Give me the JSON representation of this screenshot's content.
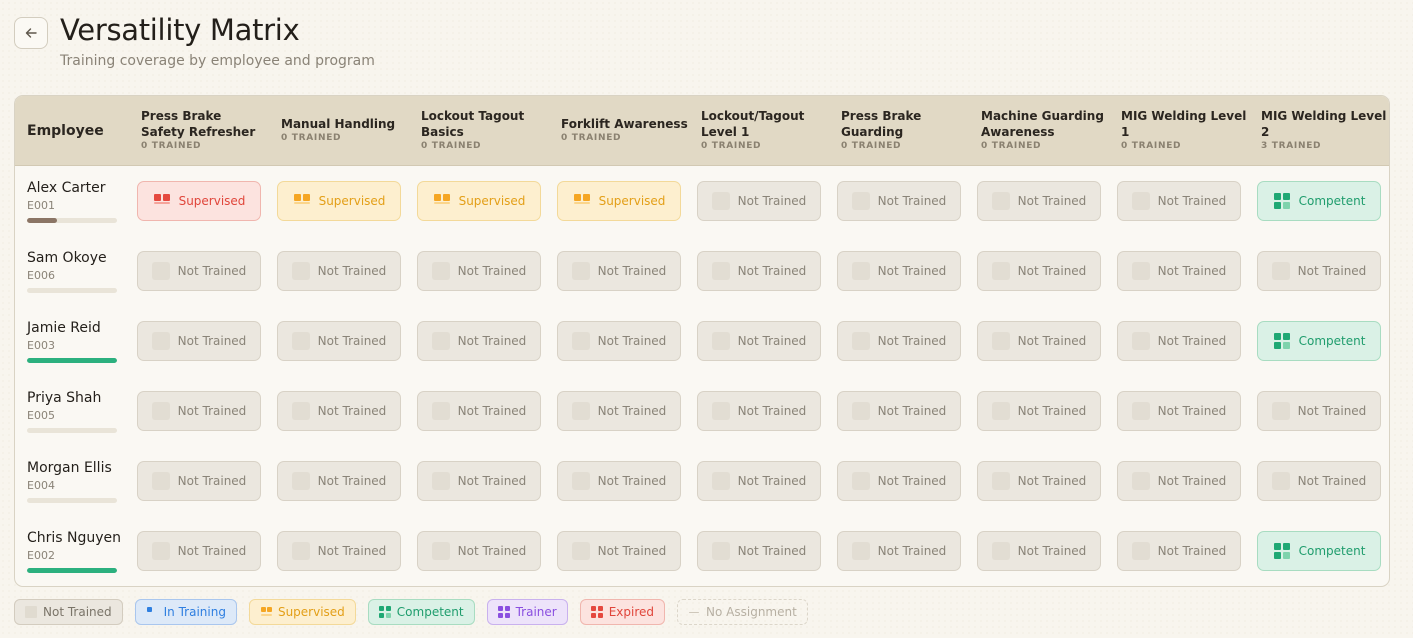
{
  "header": {
    "title": "Versatility Matrix",
    "subtitle": "Training coverage by employee and program",
    "back_icon": "arrow-left-icon"
  },
  "table": {
    "employee_header": "Employee",
    "programs": [
      {
        "name": "Press Brake Safety Refresher",
        "trained": "0 TRAINED"
      },
      {
        "name": "Manual Handling",
        "trained": "0 TRAINED"
      },
      {
        "name": "Lockout Tagout Basics",
        "trained": "0 TRAINED"
      },
      {
        "name": "Forklift Awareness",
        "trained": "0 TRAINED"
      },
      {
        "name": "Lockout/Tagout Level 1",
        "trained": "0 TRAINED"
      },
      {
        "name": "Press Brake Guarding",
        "trained": "0 TRAINED"
      },
      {
        "name": "Machine Guarding Awareness",
        "trained": "0 TRAINED"
      },
      {
        "name": "MIG Welding Level 1",
        "trained": "0 TRAINED"
      },
      {
        "name": "MIG Welding Level 2",
        "trained": "3 TRAINED"
      }
    ],
    "rows": [
      {
        "name": "Alex Carter",
        "id": "E001",
        "progress": 0.33,
        "progress_color": "#8b7565",
        "cells": [
          "Supervised",
          "Supervised",
          "Supervised",
          "Supervised",
          "Not Trained",
          "Not Trained",
          "Not Trained",
          "Not Trained",
          "Competent"
        ],
        "states": [
          "expired-supervised",
          "supervised",
          "supervised",
          "supervised",
          "not-trained",
          "not-trained",
          "not-trained",
          "not-trained",
          "competent"
        ]
      },
      {
        "name": "Sam Okoye",
        "id": "E006",
        "progress": 0,
        "progress_color": "#2bb07e",
        "cells": [
          "Not Trained",
          "Not Trained",
          "Not Trained",
          "Not Trained",
          "Not Trained",
          "Not Trained",
          "Not Trained",
          "Not Trained",
          "Not Trained"
        ],
        "states": [
          "not-trained",
          "not-trained",
          "not-trained",
          "not-trained",
          "not-trained",
          "not-trained",
          "not-trained",
          "not-trained",
          "not-trained"
        ]
      },
      {
        "name": "Jamie Reid",
        "id": "E003",
        "progress": 1,
        "progress_color": "#2bb07e",
        "cells": [
          "Not Trained",
          "Not Trained",
          "Not Trained",
          "Not Trained",
          "Not Trained",
          "Not Trained",
          "Not Trained",
          "Not Trained",
          "Competent"
        ],
        "states": [
          "not-trained",
          "not-trained",
          "not-trained",
          "not-trained",
          "not-trained",
          "not-trained",
          "not-trained",
          "not-trained",
          "competent"
        ]
      },
      {
        "name": "Priya Shah",
        "id": "E005",
        "progress": 0,
        "progress_color": "#2bb07e",
        "cells": [
          "Not Trained",
          "Not Trained",
          "Not Trained",
          "Not Trained",
          "Not Trained",
          "Not Trained",
          "Not Trained",
          "Not Trained",
          "Not Trained"
        ],
        "states": [
          "not-trained",
          "not-trained",
          "not-trained",
          "not-trained",
          "not-trained",
          "not-trained",
          "not-trained",
          "not-trained",
          "not-trained"
        ]
      },
      {
        "name": "Morgan Ellis",
        "id": "E004",
        "progress": 0,
        "progress_color": "#2bb07e",
        "cells": [
          "Not Trained",
          "Not Trained",
          "Not Trained",
          "Not Trained",
          "Not Trained",
          "Not Trained",
          "Not Trained",
          "Not Trained",
          "Not Trained"
        ],
        "states": [
          "not-trained",
          "not-trained",
          "not-trained",
          "not-trained",
          "not-trained",
          "not-trained",
          "not-trained",
          "not-trained",
          "not-trained"
        ]
      },
      {
        "name": "Chris Nguyen",
        "id": "E002",
        "progress": 1,
        "progress_color": "#2bb07e",
        "cells": [
          "Not Trained",
          "Not Trained",
          "Not Trained",
          "Not Trained",
          "Not Trained",
          "Not Trained",
          "Not Trained",
          "Not Trained",
          "Competent"
        ],
        "states": [
          "not-trained",
          "not-trained",
          "not-trained",
          "not-trained",
          "not-trained",
          "not-trained",
          "not-trained",
          "not-trained",
          "competent"
        ]
      }
    ]
  },
  "legend": [
    {
      "label": "Not Trained",
      "key": "not-trained",
      "bg": "#ebe7df",
      "border": "#d3ccbf",
      "text": "#7a7468"
    },
    {
      "label": "In Training",
      "key": "in-training",
      "bg": "#dde9f8",
      "border": "#a9c6ee",
      "text": "#2f7fe0"
    },
    {
      "label": "Supervised",
      "key": "supervised",
      "bg": "#fdefcf",
      "border": "#f3d999",
      "text": "#e39f18"
    },
    {
      "label": "Competent",
      "key": "competent",
      "bg": "#daf1e6",
      "border": "#a8dcc1",
      "text": "#1f9d6d"
    },
    {
      "label": "Trainer",
      "key": "trainer",
      "bg": "#ede3fa",
      "border": "#c9b1ee",
      "text": "#8a4fe0"
    },
    {
      "label": "Expired",
      "key": "expired",
      "bg": "#fce3df",
      "border": "#f0b6ae",
      "text": "#e0463b"
    },
    {
      "label": "No Assignment",
      "key": "no-assignment",
      "bg": "transparent",
      "border": "#dcd6ca",
      "text": "#b7b0a3"
    }
  ],
  "colors": {
    "supervised": "#f5a623",
    "expired": "#e5493f",
    "competent": "#1fa874",
    "in_training": "#2f7fe0",
    "trainer": "#8a4fe0",
    "not_trained": "#e2ddd3"
  }
}
